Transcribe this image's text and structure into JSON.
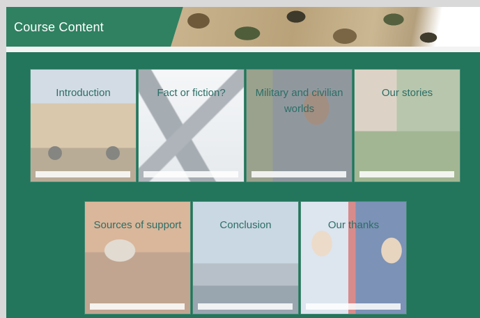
{
  "header": {
    "title": "Course Content"
  },
  "tiles": [
    {
      "label": "Introduction",
      "image_icon": "armored-vehicle-photo",
      "progress": 0.0
    },
    {
      "label": "Fact or fiction?",
      "image_icon": "fighter-jet-photo",
      "progress": 0.0
    },
    {
      "label": "Military and civilian worlds",
      "image_icon": "soldiers-photo",
      "progress": 0.0
    },
    {
      "label": "Our stories",
      "image_icon": "garden-photo",
      "progress": 0.0
    },
    {
      "label": "Sources of support",
      "image_icon": "living-room-photo",
      "progress": 0.0
    },
    {
      "label": "Conclusion",
      "image_icon": "warship-photo",
      "progress": 0.0
    },
    {
      "label": "Our thanks",
      "image_icon": "sailors-photo",
      "progress": 0.0
    }
  ],
  "colors": {
    "background": "#23755b",
    "header": "#2f8161",
    "label_text": "#2c6e66"
  }
}
